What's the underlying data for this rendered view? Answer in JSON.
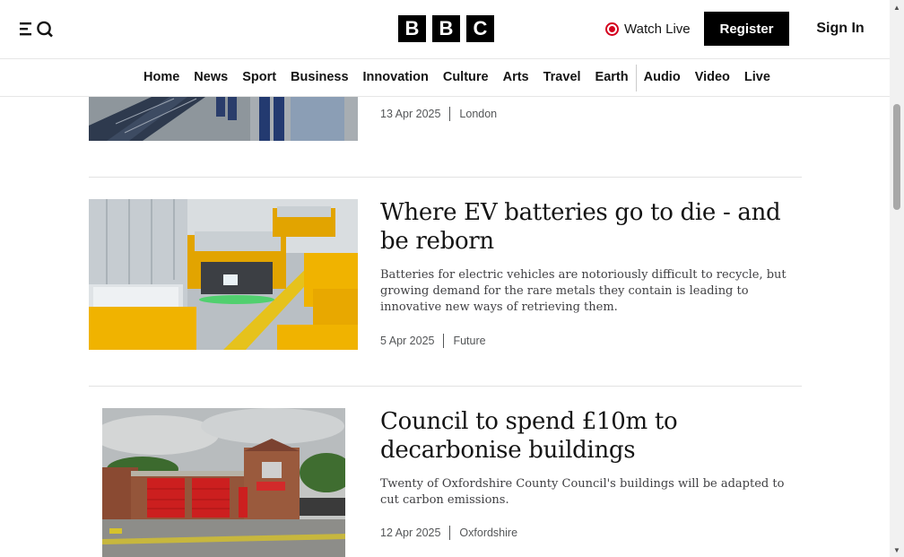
{
  "header": {
    "logo": [
      "B",
      "B",
      "C"
    ],
    "watch_live": "Watch Live",
    "register": "Register",
    "sign_in": "Sign In"
  },
  "nav": {
    "items": [
      "Home",
      "News",
      "Sport",
      "Business",
      "Innovation",
      "Culture",
      "Arts",
      "Travel",
      "Earth",
      "Audio",
      "Video",
      "Live"
    ]
  },
  "articles": [
    {
      "date": "13 Apr 2025",
      "section": "London"
    },
    {
      "headline": "Where EV batteries go to die - and be reborn",
      "summary": "Batteries for electric vehicles are notoriously difficult to recycle, but growing demand for the rare metals they contain is leading to innovative new ways of retrieving them.",
      "date": "5 Apr 2025",
      "section": "Future"
    },
    {
      "headline": "Council to spend £10m to decarbonise buildings",
      "summary": "Twenty of Oxfordshire County Council's buildings will be adapted to cut carbon emissions.",
      "date": "12 Apr 2025",
      "section": "Oxfordshire"
    }
  ],
  "colors": {
    "live_red": "#d4001e",
    "text": "#141414",
    "muted": "#545658",
    "brand_black": "#000000"
  }
}
